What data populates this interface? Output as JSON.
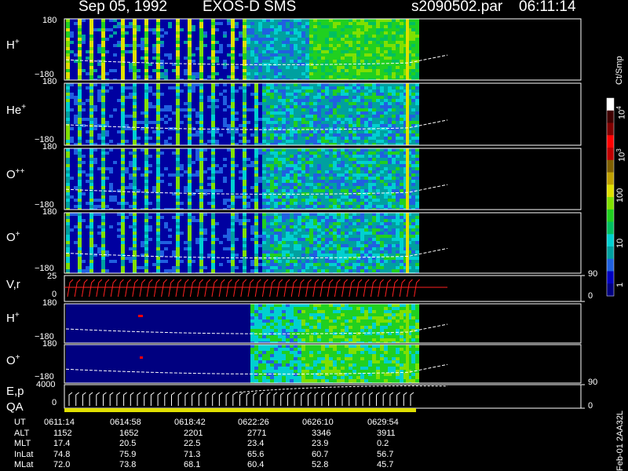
{
  "header": {
    "date": "Sep 05, 1992",
    "instrument": "EXOS-D SMS",
    "file": "s2090502.par",
    "time": "06:11:14"
  },
  "colorbar": {
    "unit": "Ct/Smp",
    "ticks": [
      "10",
      "10",
      "100",
      "10",
      "1"
    ],
    "tick_labels": [
      "10^4",
      "10^3",
      "100",
      "10",
      "1"
    ],
    "colors": [
      "#000080",
      "#0000c0",
      "#2060e0",
      "#00a0a0",
      "#00d0d0",
      "#00c060",
      "#20d020",
      "#80e000",
      "#e0e000",
      "#c0a000",
      "#806000",
      "#c00000",
      "#ff0000",
      "#800000",
      "#400000",
      "#ffffff"
    ]
  },
  "footer_tag": "Feb-01 2AA32L",
  "chart_data": [
    {
      "type": "heatmap",
      "panel": "H+",
      "label_main": "H",
      "label_sup": "+",
      "ylim": [
        -180,
        180
      ],
      "ytick_top": "180",
      "ytick_bottom": "−180",
      "colorscale_unit": "Ct/Smp"
    },
    {
      "type": "heatmap",
      "panel": "He+",
      "label_main": "He",
      "label_sup": "+",
      "ylim": [
        -180,
        180
      ],
      "ytick_top": "180",
      "ytick_bottom": "−180"
    },
    {
      "type": "heatmap",
      "panel": "O++",
      "label_main": "O",
      "label_sup": "++",
      "ylim": [
        -180,
        180
      ],
      "ytick_top": "180",
      "ytick_bottom": "−180"
    },
    {
      "type": "heatmap",
      "panel": "O+",
      "label_main": "O",
      "label_sup": "+",
      "ylim": [
        -180,
        180
      ],
      "ytick_top": "180",
      "ytick_bottom": "−180"
    },
    {
      "type": "line",
      "panel": "V,r",
      "label": "V,r",
      "ytick_top": "25",
      "ytick_bottom": "0",
      "right_top": "90",
      "right_bottom": "0"
    },
    {
      "type": "heatmap",
      "panel": "H+ (2)",
      "label_main": "H",
      "label_sup": "+",
      "ytick_top": "180",
      "ytick_bottom": "−180"
    },
    {
      "type": "heatmap",
      "panel": "O+ (2)",
      "label_main": "O",
      "label_sup": "+",
      "ytick_top": "180",
      "ytick_bottom": "−180"
    },
    {
      "type": "line",
      "panel": "E,p",
      "label": "E,p",
      "label2": "QA",
      "ytick_top": "4000",
      "ytick_bottom": "0",
      "right_top": "90",
      "right_bottom": "0"
    }
  ],
  "ephemeris": {
    "rows": [
      {
        "name": "UT",
        "values": [
          "0611:14",
          "0614:58",
          "0618:42",
          "0622:26",
          "0626:10",
          "0629:54"
        ]
      },
      {
        "name": "ALT",
        "values": [
          "1152",
          "1652",
          "2201",
          "2771",
          "3346",
          "3911"
        ]
      },
      {
        "name": "MLT",
        "values": [
          "17.4",
          "20.5",
          "22.5",
          "23.4",
          "23.9",
          "0.2"
        ]
      },
      {
        "name": "InLat",
        "values": [
          "74.8",
          "75.9",
          "71.3",
          "65.6",
          "60.7",
          "56.7"
        ]
      },
      {
        "name": "MLat",
        "values": [
          "72.0",
          "73.8",
          "68.1",
          "60.4",
          "52.8",
          "45.7"
        ]
      }
    ]
  }
}
